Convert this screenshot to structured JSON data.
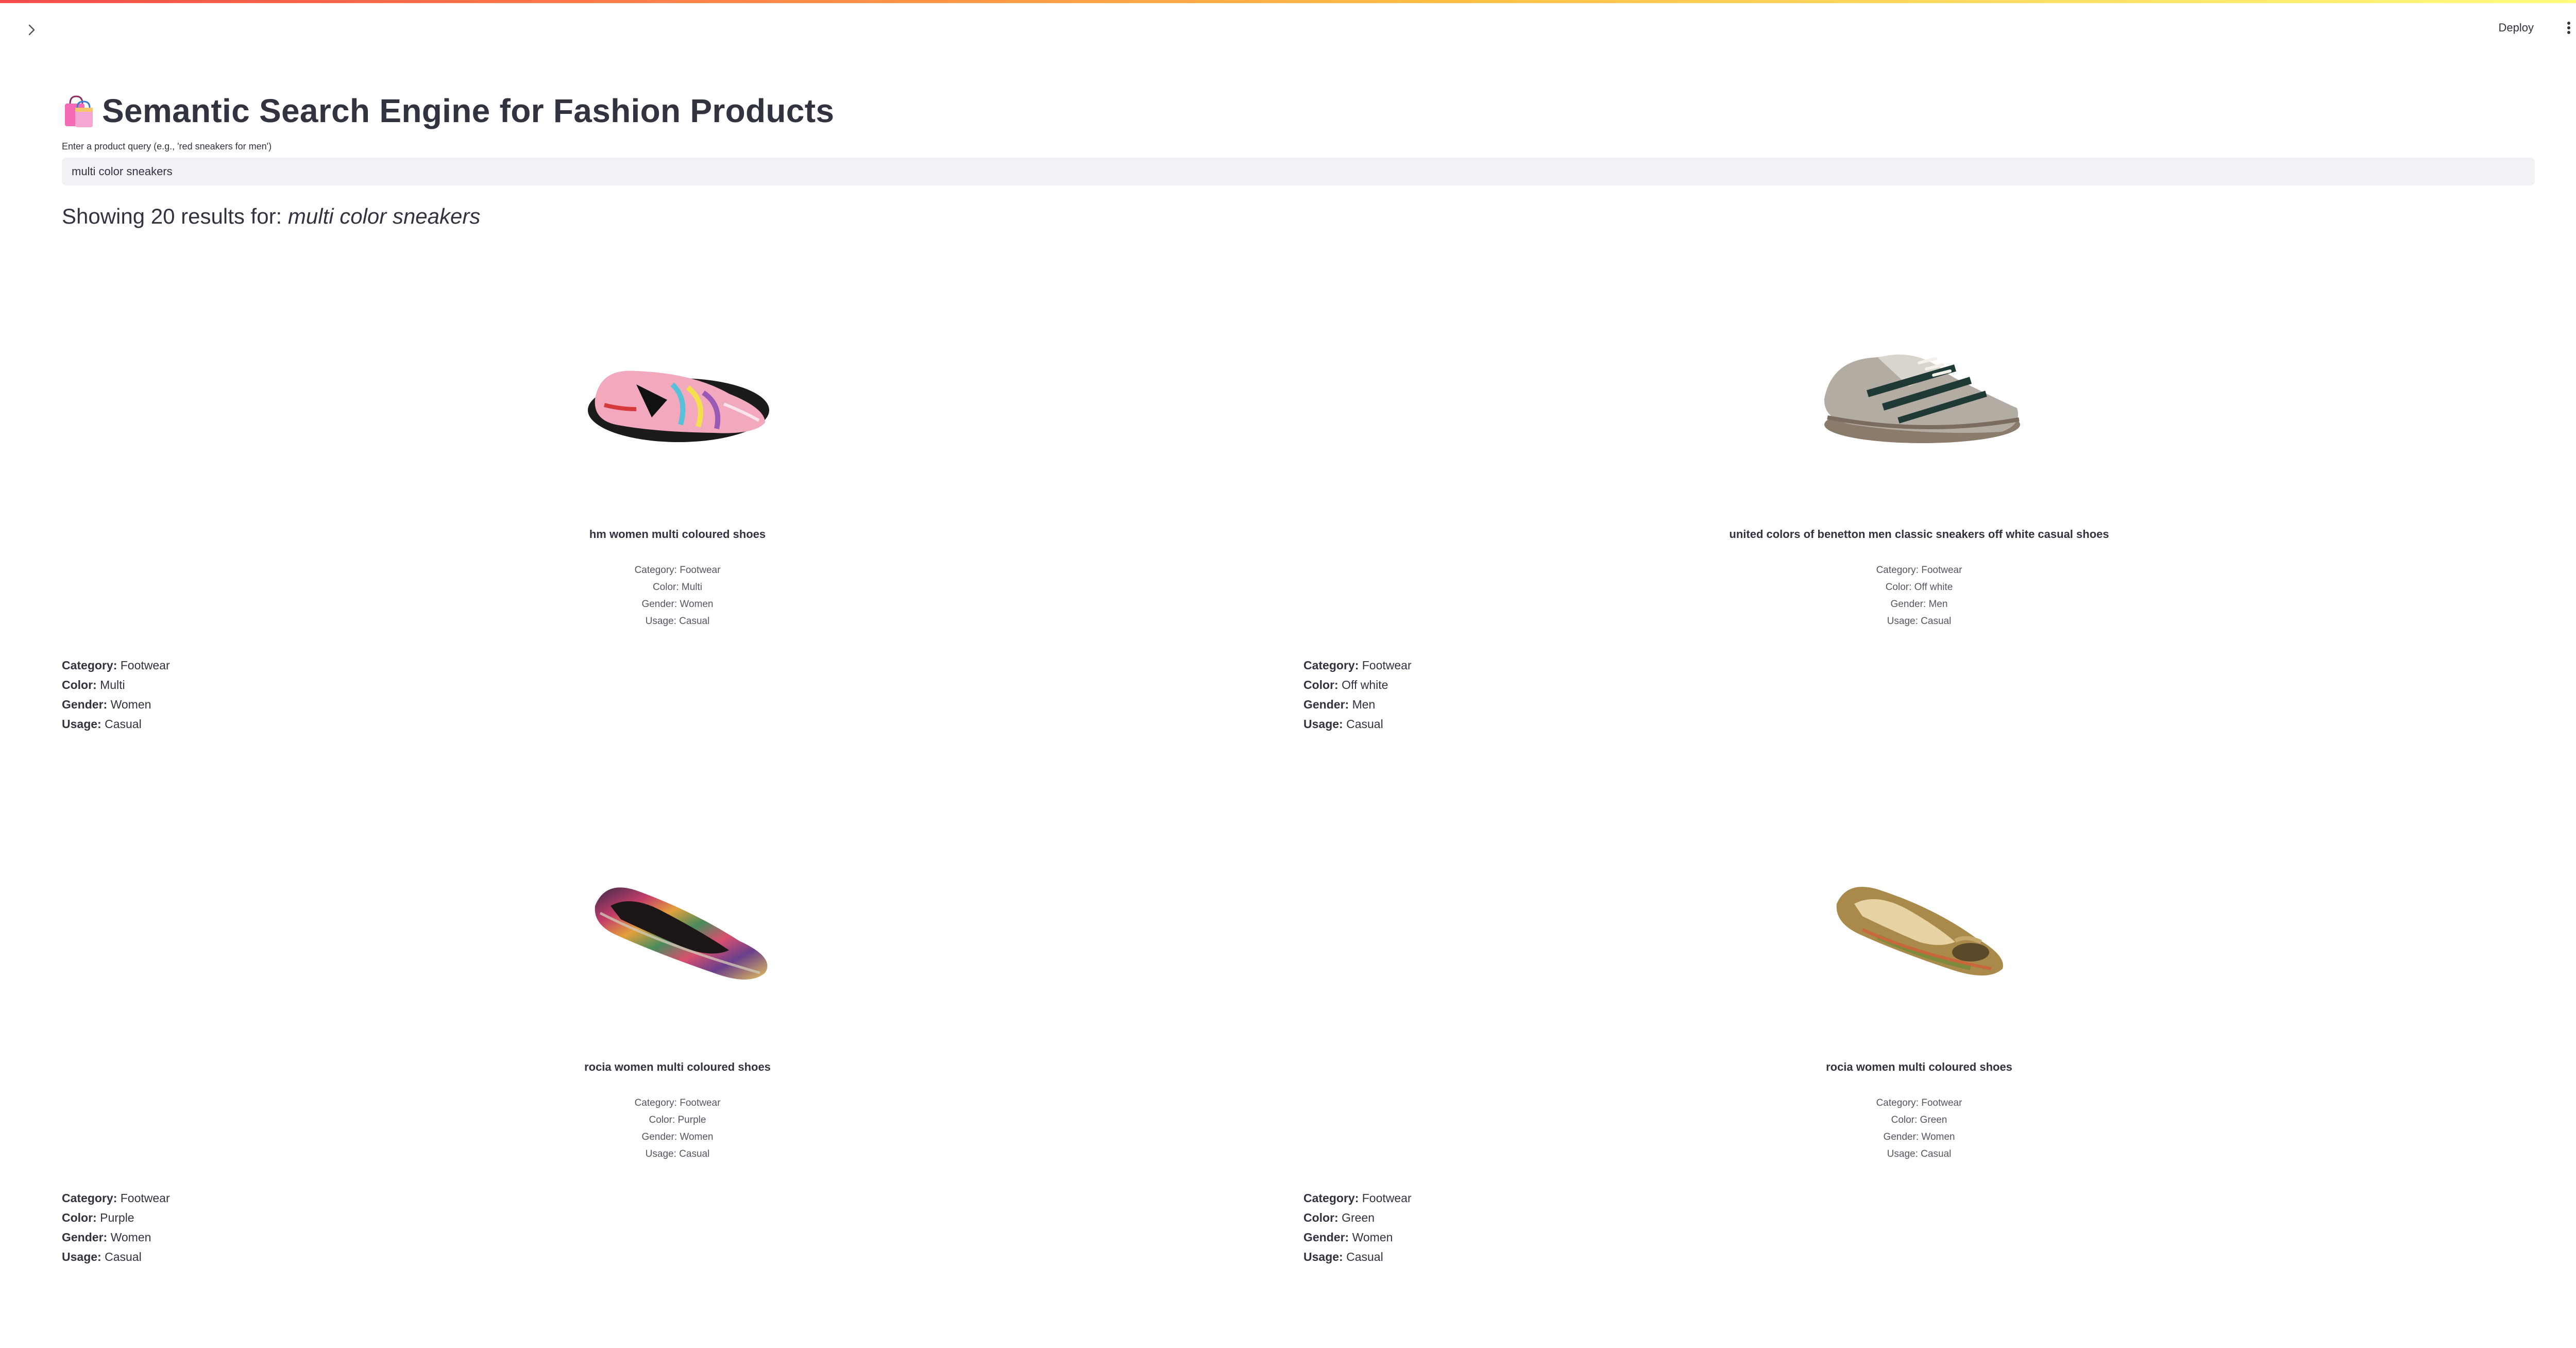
{
  "header": {
    "deploy_label": "Deploy"
  },
  "main": {
    "title": "Semantic Search Engine for Fashion Products",
    "title_icon": "shopping-bags-icon",
    "query_label": "Enter a product query (e.g., 'red sneakers for men')",
    "query_value": "multi color sneakers",
    "results_prefix": "Showing 20 results for: ",
    "results_query": "multi color sneakers"
  },
  "labels": {
    "category": "Category:",
    "color": "Color:",
    "gender": "Gender:",
    "usage": "Usage:"
  },
  "products": [
    {
      "name": "hm women multi coloured shoes",
      "image": "pink-flat-shoe",
      "category": "Footwear",
      "color": "Multi",
      "gender": "Women",
      "usage": "Casual",
      "meta_category": "Category: Footwear",
      "meta_color": "Color: Multi",
      "meta_gender": "Gender: Women",
      "meta_usage": "Usage: Casual"
    },
    {
      "name": "united colors of benetton men classic sneakers off white casual shoes",
      "image": "grey-sneaker",
      "category": "Footwear",
      "color": "Off white",
      "gender": "Men",
      "usage": "Casual",
      "meta_category": "Category: Footwear",
      "meta_color": "Color: Off white",
      "meta_gender": "Gender: Men",
      "meta_usage": "Usage: Casual"
    },
    {
      "name": "rocia women multi coloured shoes",
      "image": "striped-ballet-flat",
      "category": "Footwear",
      "color": "Purple",
      "gender": "Women",
      "usage": "Casual",
      "meta_category": "Category: Footwear",
      "meta_color": "Color: Purple",
      "meta_gender": "Gender: Women",
      "meta_usage": "Usage: Casual"
    },
    {
      "name": "rocia women multi coloured shoes",
      "image": "olive-peep-toe-flat",
      "category": "Footwear",
      "color": "Green",
      "gender": "Women",
      "usage": "Casual",
      "meta_category": "Category: Footwear",
      "meta_color": "Color: Green",
      "meta_gender": "Gender: Women",
      "meta_usage": "Usage: Casual"
    }
  ],
  "colors": {
    "accent_start": "#ff4b4b",
    "accent_end": "#fffd80",
    "input_bg": "#f0f2f6",
    "text": "#31333f"
  }
}
